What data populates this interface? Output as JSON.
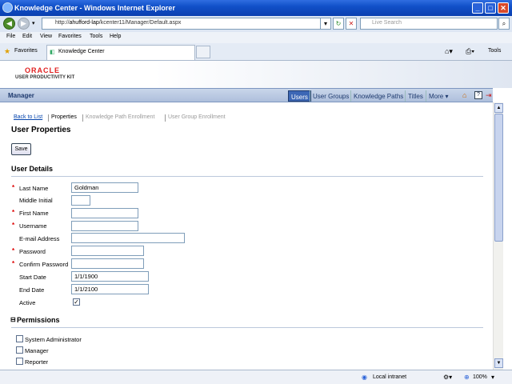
{
  "window": {
    "title": "Knowledge Center - Windows Internet Explorer"
  },
  "address": {
    "url_prefix": "http://",
    "url_host": "ahufford-lap",
    "url_path": "/kcenter11/Manager/Default.aspx",
    "search_placeholder": "Live Search"
  },
  "menu": {
    "items": [
      "File",
      "Edit",
      "View",
      "Favorites",
      "Tools",
      "Help"
    ]
  },
  "favbar": {
    "favorites_label": "Favorites",
    "tab_label": "Knowledge Center",
    "tools_label": "Tools"
  },
  "brand": {
    "name": "ORACLE",
    "product": "USER PRODUCTIVITY KIT"
  },
  "navbar": {
    "section": "Manager",
    "items": [
      "Users",
      "User Groups",
      "Knowledge Paths",
      "Titles",
      "More"
    ]
  },
  "crumbs": {
    "back": "Back to List",
    "properties": "Properties",
    "kp": "Knowledge Path Enrollment",
    "ug": "User Group Enrollment"
  },
  "page": {
    "title": "User Properties",
    "save": "Save",
    "details": "User Details",
    "permissions": "Permissions",
    "permissions_toggle": "⊟"
  },
  "fields": {
    "last_name": {
      "label": "Last Name",
      "value": "Goldman"
    },
    "middle_initial": {
      "label": "Middle Initial",
      "value": ""
    },
    "first_name": {
      "label": "First Name",
      "value": ""
    },
    "username": {
      "label": "Username",
      "value": ""
    },
    "email": {
      "label": "E-mail Address",
      "value": ""
    },
    "password": {
      "label": "Password",
      "value": ""
    },
    "confirm_password": {
      "label": "Confirm Password",
      "value": ""
    },
    "start_date": {
      "label": "Start Date",
      "value": "1/1/1900"
    },
    "end_date": {
      "label": "End Date",
      "value": "1/1/2100"
    },
    "active": {
      "label": "Active",
      "checked": true
    }
  },
  "required_marker": "*",
  "perms": {
    "items": [
      "System Administrator",
      "Manager",
      "Reporter"
    ]
  },
  "status": {
    "zone": "Local intranet",
    "zoom": "100%"
  },
  "colors": {
    "accent": "#3c67b5",
    "required": "#dd0000",
    "brand": "#e02020"
  }
}
